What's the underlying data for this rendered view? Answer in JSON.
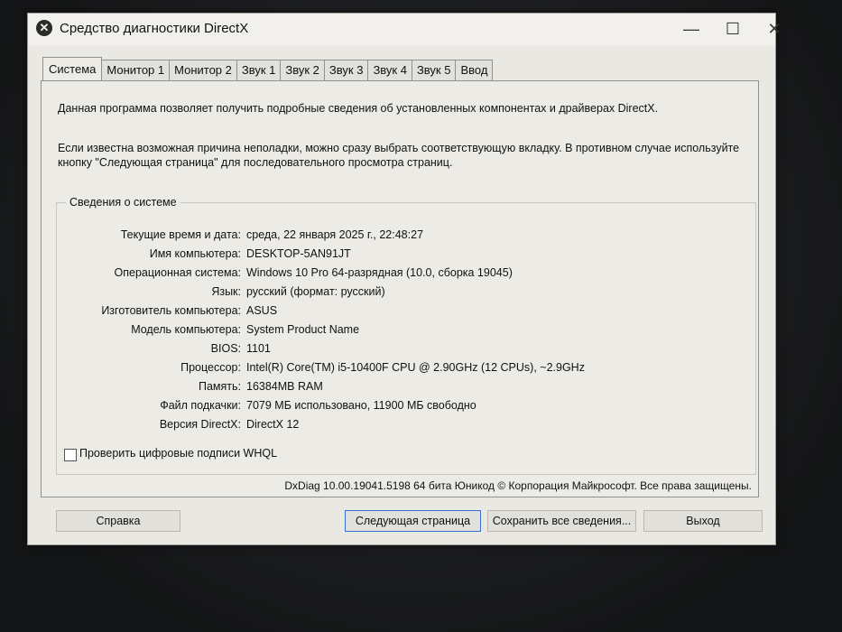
{
  "window": {
    "title": "Средство диагностики DirectX",
    "minimize": "—",
    "maximize": "☐",
    "close": "✕",
    "app_icon": "✕"
  },
  "tabs": [
    {
      "label": "Система",
      "active": true
    },
    {
      "label": "Монитор 1"
    },
    {
      "label": "Монитор 2"
    },
    {
      "label": "Звук 1"
    },
    {
      "label": "Звук 2"
    },
    {
      "label": "Звук 3"
    },
    {
      "label": "Звук 4"
    },
    {
      "label": "Звук 5"
    },
    {
      "label": "Ввод"
    }
  ],
  "intro": {
    "line1": "Данная программа позволяет получить подробные сведения об установленных компонентах и драйверах DirectX.",
    "line2": "Если известна возможная причина неполадки, можно сразу выбрать соответствующую вкладку. В противном случае используйте кнопку \"Следующая страница\" для последовательного просмотра страниц."
  },
  "system_info": {
    "group_title": "Сведения о системе",
    "rows": [
      {
        "label": "Текущие время и дата:",
        "value": "среда, 22 января 2025 г., 22:48:27"
      },
      {
        "label": "Имя компьютера:",
        "value": "DESKTOP-5AN91JT"
      },
      {
        "label": "Операционная система:",
        "value": "Windows 10 Pro 64-разрядная (10.0, сборка 19045)"
      },
      {
        "label": "Язык:",
        "value": "русский (формат: русский)"
      },
      {
        "label": "Изготовитель компьютера:",
        "value": "ASUS"
      },
      {
        "label": "Модель компьютера:",
        "value": "System Product Name"
      },
      {
        "label": "BIOS:",
        "value": "1101"
      },
      {
        "label": "Процессор:",
        "value": "Intel(R) Core(TM) i5-10400F CPU @ 2.90GHz (12 CPUs), ~2.9GHz"
      },
      {
        "label": "Память:",
        "value": "16384MB RAM"
      },
      {
        "label": "Файл подкачки:",
        "value": "7079 МБ использовано, 11900 МБ свободно"
      },
      {
        "label": "Версия DirectX:",
        "value": "DirectX 12"
      }
    ]
  },
  "whql": {
    "label": "Проверить цифровые подписи WHQL",
    "checked": false
  },
  "footer": "DxDiag 10.00.19041.5198 64 бита Юникод © Корпорация Майкрософт. Все права защищены.",
  "buttons": {
    "help": "Справка",
    "next": "Следующая страница",
    "save": "Сохранить все сведения...",
    "exit": "Выход"
  }
}
